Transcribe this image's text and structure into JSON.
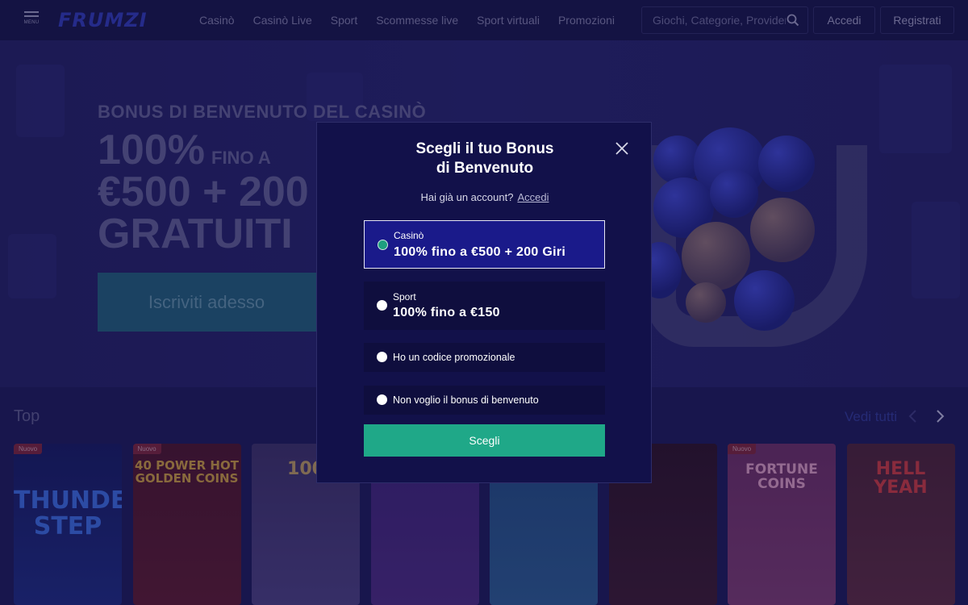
{
  "header": {
    "menu_label": "MENU",
    "logo": "FRUMZI",
    "nav": [
      "Casinò",
      "Casinò Live",
      "Sport",
      "Scommesse live",
      "Sport virtuali",
      "Promozioni"
    ],
    "search_placeholder": "Giochi, Categorie, Provider",
    "login_label": "Accedi",
    "register_label": "Registrati"
  },
  "hero": {
    "subtitle": "BONUS DI BENVENUTO DEL CASINÒ",
    "line1_big": "100%",
    "line1_small": "FINO A",
    "line2": "€500 + 200",
    "line3": "GRATUITI",
    "cta": "Iscriviti adesso"
  },
  "top": {
    "title": "Top",
    "see_all": "Vedi tutti",
    "games": [
      {
        "name": "THUNDER STEP",
        "badge": "Nuovo",
        "bg": "#1c2a7a",
        "color": "#3a6ad8"
      },
      {
        "name": "40 POWER HOT GOLDEN COINS",
        "badge": "Nuovo",
        "bg": "#5a1a2a",
        "color": "#c89a3a"
      },
      {
        "name": "100",
        "badge": "",
        "bg": "#4a3f7a",
        "color": "#b89a5a"
      },
      {
        "name": "",
        "badge": "",
        "bg": "#4a2a7a",
        "color": "#9a6ad8"
      },
      {
        "name": "",
        "badge": "",
        "bg": "#2a5a8a",
        "color": "#6aa8d8"
      },
      {
        "name": "",
        "badge": "",
        "bg": "#3a1a2a",
        "color": "#8a3a3a"
      },
      {
        "name": "FORTUNE COINS",
        "badge": "Nuovo",
        "bg": "#7a3a6a",
        "color": "#d89ab8"
      },
      {
        "name": "HELL YEAH",
        "badge": "",
        "bg": "#5a2a3a",
        "color": "#c83a3a"
      }
    ]
  },
  "modal": {
    "title_line1": "Scegli il tuo Bonus",
    "title_line2": "di Benvenuto",
    "account_prompt": "Hai già un account?",
    "account_link": "Accedi",
    "options": {
      "casino_category": "Casinò",
      "casino_value": "100% fino a €500 + 200 Giri",
      "sport_category": "Sport",
      "sport_value": "100% fino a €150",
      "promo_code": "Ho un codice promozionale",
      "no_bonus": "Non voglio il bonus di benvenuto"
    },
    "selected": "casino",
    "choose_label": "Scegli"
  },
  "colors": {
    "accent": "#1fa888",
    "modal_bg": "#12114a",
    "selected_option_bg": "#1a1a8a"
  }
}
